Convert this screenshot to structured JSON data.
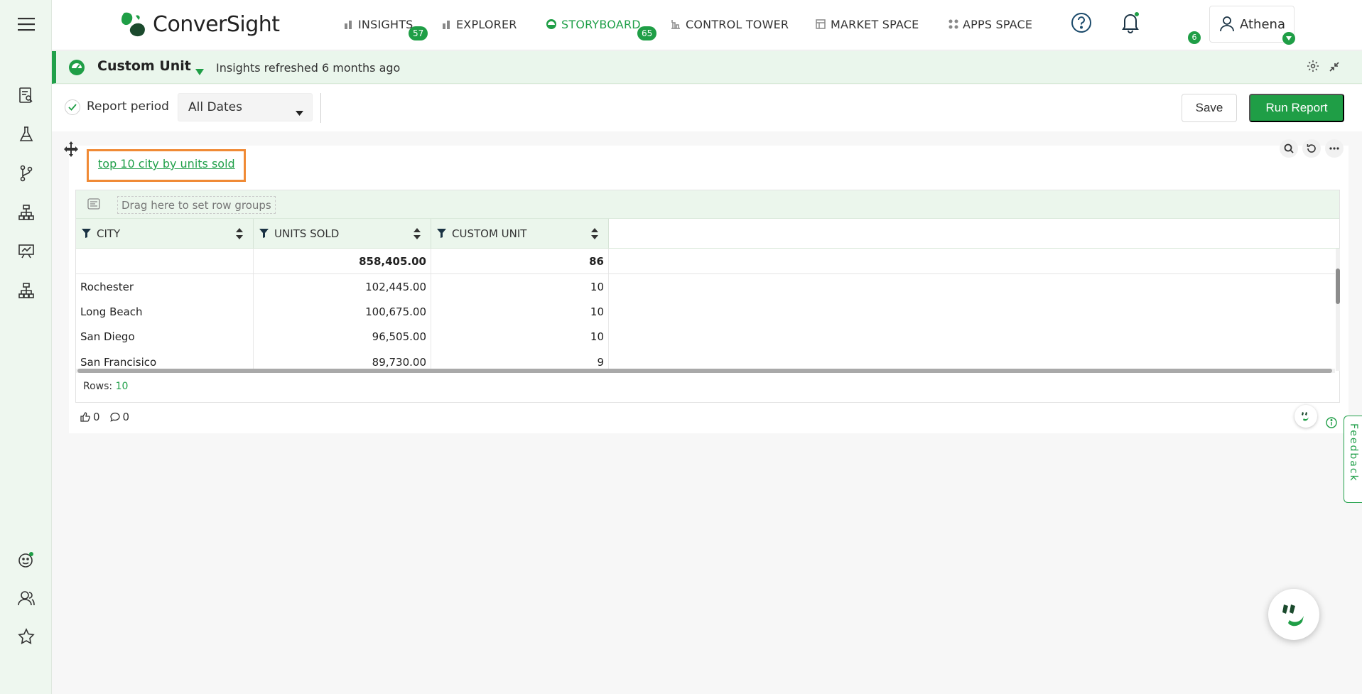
{
  "brand": {
    "name": "ConverSight"
  },
  "nav": [
    {
      "label": "INSIGHTS",
      "badge": "57"
    },
    {
      "label": "EXPLORER"
    },
    {
      "label": "STORYBOARD",
      "badge": "65",
      "active": true
    },
    {
      "label": "CONTROL TOWER"
    },
    {
      "label": "MARKET SPACE"
    },
    {
      "label": "APPS SPACE"
    }
  ],
  "notifications": {
    "count": "6"
  },
  "user": {
    "name": "Athena"
  },
  "unit": {
    "title": "Custom Unit",
    "refreshed": "Insights refreshed 6 months ago"
  },
  "filters": {
    "report_period_label": "Report period",
    "dates_value": "All Dates",
    "save_label": "Save",
    "run_label": "Run Report"
  },
  "widget": {
    "title": "top 10 city by units sold",
    "row_group_placeholder": "Drag here to set row groups",
    "columns": [
      "CITY",
      "UNITS SOLD",
      "CUSTOM UNIT"
    ],
    "totals": {
      "city": "",
      "units_sold": "858,405.00",
      "custom_unit": "86"
    },
    "rows": [
      {
        "city": "Rochester",
        "units_sold": "102,445.00",
        "custom_unit": "10"
      },
      {
        "city": "Long Beach",
        "units_sold": "100,675.00",
        "custom_unit": "10"
      },
      {
        "city": "San Diego",
        "units_sold": "96,505.00",
        "custom_unit": "10"
      },
      {
        "city": "San Francisico",
        "units_sold": "89,730.00",
        "custom_unit": "9"
      }
    ],
    "rows_label": "Rows:",
    "rows_count": "10",
    "likes": "0",
    "comments": "0"
  },
  "feedback": {
    "label": "Feedback"
  },
  "colors": {
    "accent": "#1f9e46",
    "highlight": "#f08a35",
    "sidebar_bg": "#eef7ef"
  }
}
